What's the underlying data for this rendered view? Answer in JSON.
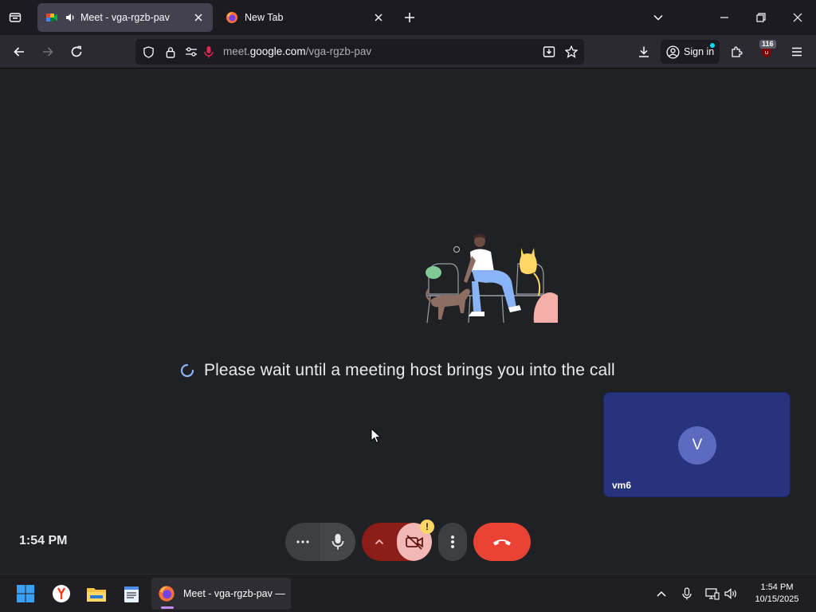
{
  "browser": {
    "tabs": [
      {
        "title": "Meet - vga-rgzb-pav",
        "active": true
      },
      {
        "title": "New Tab",
        "active": false
      }
    ],
    "url_prefix": "meet.",
    "url_host": "google.com",
    "url_path": "/vga-rgzb-pav",
    "signin_label": "Sign in",
    "extension_badge": "116"
  },
  "meet": {
    "wait_message": "Please wait until a meeting host brings you into the call",
    "self_tile": {
      "initial": "V",
      "name": "vm6"
    },
    "clock": "1:54 PM",
    "camera_warning": "!"
  },
  "taskbar": {
    "app_title": "Meet - vga-rgzb-pav —",
    "time": "1:54 PM",
    "date": "10/15/2025"
  },
  "colors": {
    "meet_bg": "#202124",
    "hangup": "#ea4335",
    "tile": "#27337d",
    "accent": "#00ddff"
  }
}
